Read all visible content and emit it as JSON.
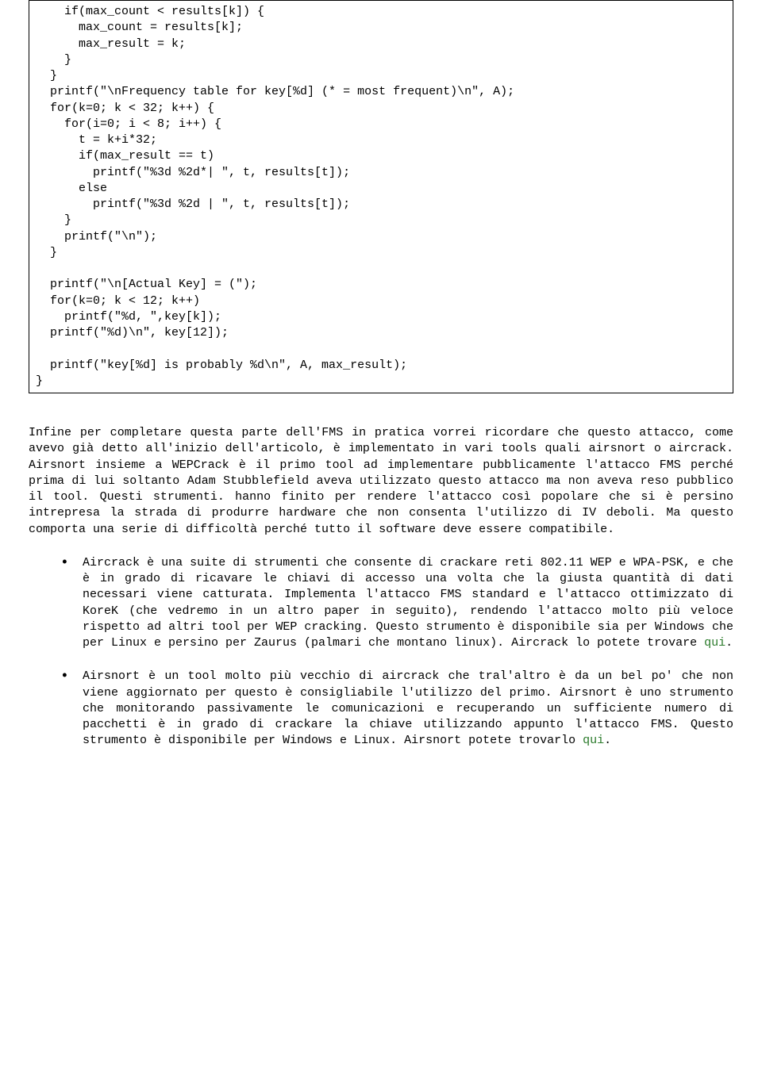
{
  "code": "    if(max_count < results[k]) {\n      max_count = results[k];\n      max_result = k;\n    }\n  }\n  printf(\"\\nFrequency table for key[%d] (* = most frequent)\\n\", A);\n  for(k=0; k < 32; k++) {\n    for(i=0; i < 8; i++) {\n      t = k+i*32;\n      if(max_result == t)\n        printf(\"%3d %2d*| \", t, results[t]);\n      else\n        printf(\"%3d %2d | \", t, results[t]);\n    }\n    printf(\"\\n\");\n  }\n\n  printf(\"\\n[Actual Key] = (\");\n  for(k=0; k < 12; k++)\n    printf(\"%d, \",key[k]);\n  printf(\"%d)\\n\", key[12]);\n\n  printf(\"key[%d] is probably %d\\n\", A, max_result);\n}",
  "paragraph": "Infine per completare questa parte dell'FMS in pratica vorrei ricordare che questo attacco, come avevo già detto all'inizio dell'articolo, è implementato in vari tools quali airsnort o aircrack. Airsnort insieme a WEPCrack è il primo tool ad implementare pubblicamente l'attacco FMS perché prima di lui soltanto Adam Stubblefield aveva utilizzato questo attacco ma non aveva reso pubblico il tool. Questi strumenti. hanno finito per rendere l'attacco così popolare che si è persino intrepresa la strada di produrre hardware che non consenta l'utilizzo di IV deboli. Ma questo comporta una serie di difficoltà perché tutto il software deve essere compatibile.",
  "bullets": [
    {
      "pre": "Aircrack è una suite di strumenti che consente di crackare reti 802.11 WEP e WPA-PSK, e che è in grado di ricavare le chiavi di accesso una volta che la giusta quantità di dati necessari viene catturata. Implementa l'attacco FMS standard e l'attacco ottimizzato di KoreK (che vedremo in un altro paper in seguito), rendendo l'attacco molto più veloce rispetto ad altri tool per WEP cracking. Questo strumento è disponibile sia per Windows che per Linux e persino per Zaurus (palmari che montano linux). Aircrack lo potete trovare ",
      "link": "qui",
      "post": "."
    },
    {
      "pre": "Airsnort è un tool molto più vecchio di aircrack che tral'altro è da un bel po' che non viene aggiornato per questo è consigliabile l'utilizzo del primo. Airsnort è uno strumento che monitorando passivamente le comunicazioni e recuperando un sufficiente numero di pacchetti è in grado di crackare la chiave utilizzando appunto l'attacco FMS. Questo strumento è disponibile per Windows e Linux. Airsnort potete trovarlo ",
      "link": "qui",
      "post": "."
    }
  ]
}
